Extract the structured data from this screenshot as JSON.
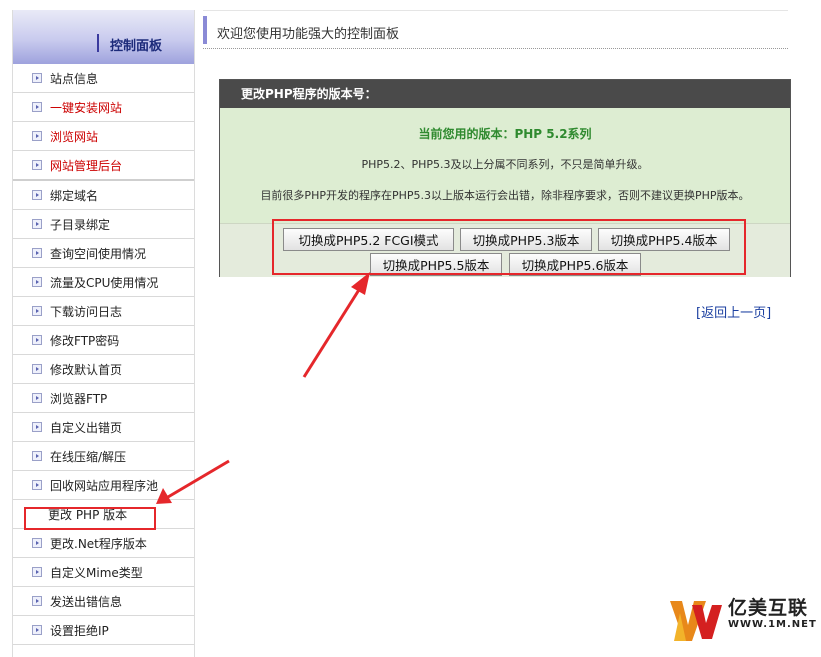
{
  "sidebar": {
    "title": "控制面板",
    "items": [
      {
        "label": "站点信息",
        "style": "normal"
      },
      {
        "label": "一键安装网站",
        "style": "red"
      },
      {
        "label": "浏览网站",
        "style": "red"
      },
      {
        "label": "网站管理后台",
        "style": "red"
      },
      {
        "label": "绑定域名",
        "style": "normal"
      },
      {
        "label": "子目录绑定",
        "style": "normal"
      },
      {
        "label": "查询空间使用情况",
        "style": "normal"
      },
      {
        "label": "流量及CPU使用情况",
        "style": "normal"
      },
      {
        "label": "下载访问日志",
        "style": "normal"
      },
      {
        "label": "修改FTP密码",
        "style": "normal"
      },
      {
        "label": "修改默认首页",
        "style": "normal"
      },
      {
        "label": "浏览器FTP",
        "style": "normal"
      },
      {
        "label": "自定义出错页",
        "style": "normal"
      },
      {
        "label": "在线压缩/解压",
        "style": "normal"
      },
      {
        "label": "回收网站应用程序池",
        "style": "normal"
      },
      {
        "label": "更改 PHP 版本",
        "style": "plain"
      },
      {
        "label": "更改.Net程序版本",
        "style": "normal"
      },
      {
        "label": "自定义Mime类型",
        "style": "normal"
      },
      {
        "label": "发送出错信息",
        "style": "normal"
      },
      {
        "label": "设置拒绝IP",
        "style": "normal"
      }
    ]
  },
  "header": {
    "welcome": "欢迎您使用功能强大的控制面板"
  },
  "panel": {
    "title": "更改PHP程序的版本号：",
    "current_label": "当前您用的版本：",
    "current_version": "PHP 5.2系列",
    "note1": "PHP5.2、PHP5.3及以上分属不同系列，不只是简单升级。",
    "note2": "目前很多PHP开发的程序在PHP5.3以上版本运行会出错，除非程序要求，否则不建议更换PHP版本。",
    "buttons": [
      "切换成PHP5.2 FCGI模式",
      "切换成PHP5.3版本",
      "切换成PHP5.4版本",
      "切换成PHP5.5版本",
      "切换成PHP5.6版本"
    ]
  },
  "back_link": "[返回上一页]",
  "watermark": {
    "name": "亿美互联",
    "url": "WWW.1M.NET"
  },
  "colors": {
    "highlight": "#e5272b",
    "current_version": "#2f8a2f",
    "link": "#1b3fa0"
  }
}
